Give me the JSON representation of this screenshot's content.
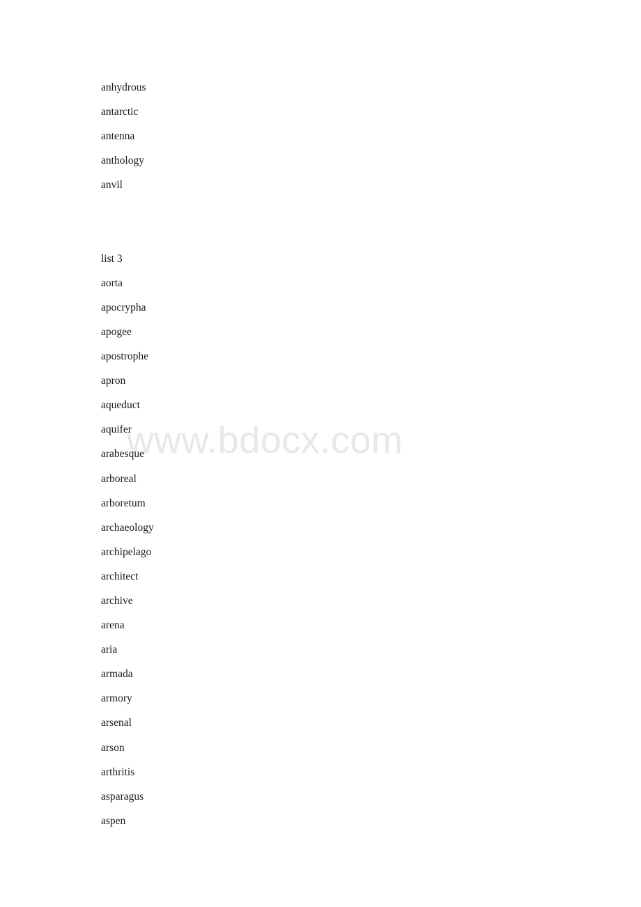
{
  "document": {
    "watermark": "www.bdocx.com",
    "text_color": "#1a1a1a",
    "watermark_color": "#e7e8e8",
    "background_color": "#ffffff",
    "blocks": [
      {
        "name": "word-list-continuation",
        "lines": [
          "anhydrous",
          "antarctic",
          "antenna",
          "anthology",
          "anvil"
        ]
      },
      {
        "name": "spacer",
        "lines": [
          "",
          ""
        ]
      },
      {
        "name": "list-3",
        "heading": "list 3",
        "lines": [
          "list 3",
          "aorta",
          "apocrypha",
          "apogee",
          "apostrophe",
          "apron",
          "aqueduct",
          "aquifer",
          "arabesque",
          "arboreal",
          "arboretum",
          "archaeology",
          "archipelago",
          "architect",
          "archive",
          "arena",
          "aria",
          "armada",
          "armory",
          "arsenal",
          "arson",
          "arthritis",
          "asparagus",
          "aspen"
        ]
      }
    ]
  }
}
